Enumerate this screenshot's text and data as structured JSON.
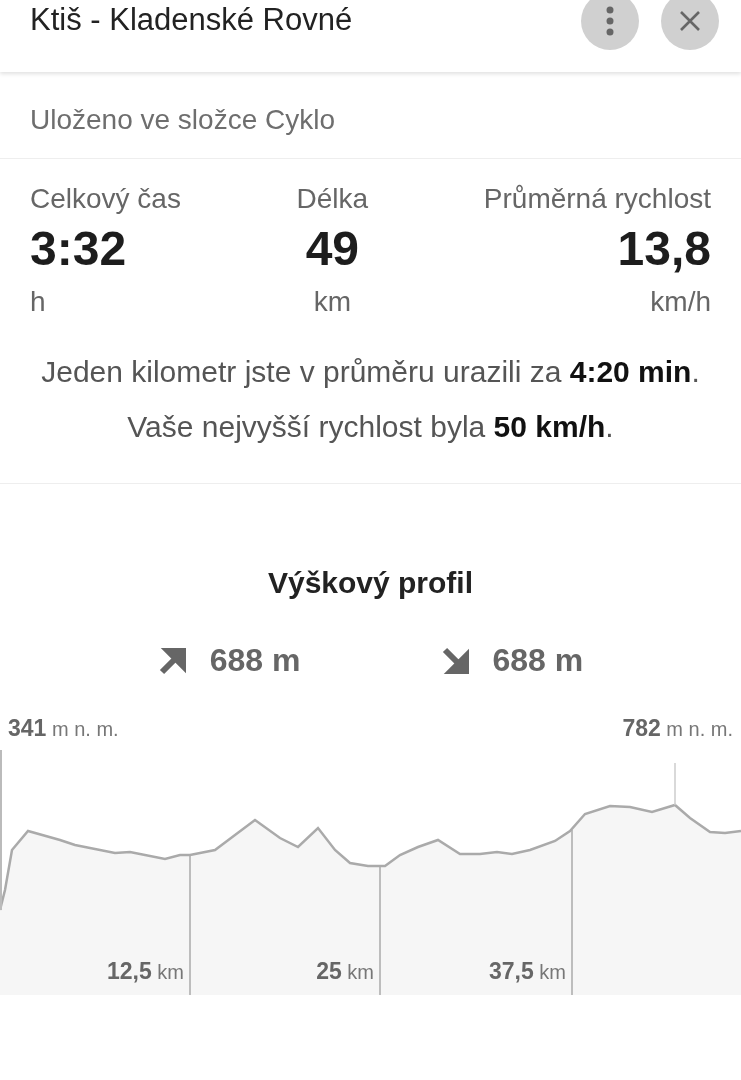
{
  "header": {
    "title": "Ktiš - Kladenské Rovné"
  },
  "folder": "Uloženo ve složce Cyklo",
  "stats": [
    {
      "label": "Celkový čas",
      "value": "3:32",
      "unit": "h"
    },
    {
      "label": "Délka",
      "value": "49",
      "unit": "km"
    },
    {
      "label": "Průměrná rychlost",
      "value": "13,8",
      "unit": "km/h"
    }
  ],
  "summary": [
    "Jeden kilometr jste v průměru urazili za **4:20 min**.",
    "Vaše nejvyšší rychlost byla **50 km/h**."
  ],
  "profile": {
    "title": "Výškový profil",
    "ascent": "688 m",
    "descent": "688 m",
    "start_label": "**341** m n. m.",
    "max_label": "**782** m n. m.",
    "distance_marks": [
      "**12,5** km",
      "**25** km",
      "**37,5** km"
    ]
  }
}
